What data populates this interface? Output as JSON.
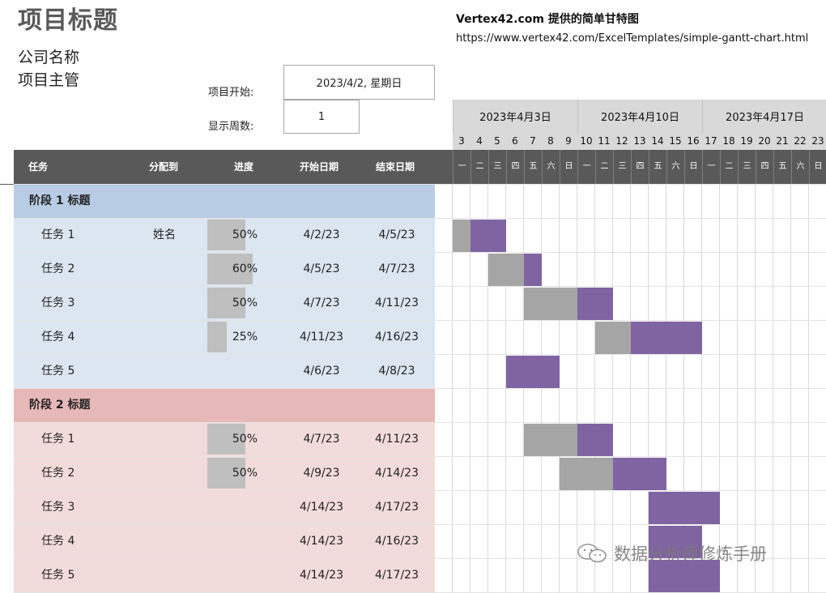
{
  "header": {
    "title": "项目标题",
    "company": "公司名称",
    "manager": "项目主管",
    "credit": "Vertex42.com 提供的简单甘特图",
    "url": "https://www.vertex42.com/ExcelTemplates/simple-gantt-chart.html"
  },
  "settings": {
    "start_label": "项目开始:",
    "start_value": "2023/4/2, 星期日",
    "weeks_label": "显示周数:",
    "weeks_value": "1"
  },
  "columns": {
    "task": "任务",
    "assigned": "分配到",
    "progress": "进度",
    "start": "开始日期",
    "end": "结束日期"
  },
  "timeline": {
    "weeks": [
      "2023年4月3日",
      "2023年4月10日",
      "2023年4月17日"
    ],
    "days": [
      "3",
      "4",
      "5",
      "6",
      "7",
      "8",
      "9",
      "10",
      "11",
      "12",
      "13",
      "14",
      "15",
      "16",
      "17",
      "18",
      "19",
      "20",
      "21",
      "22",
      "23"
    ],
    "day_names": [
      "一",
      "二",
      "三",
      "四",
      "五",
      "六",
      "日",
      "一",
      "二",
      "三",
      "四",
      "五",
      "六",
      "日",
      "一",
      "二",
      "三",
      "四",
      "五",
      "六",
      "日"
    ]
  },
  "phases": [
    {
      "label": "阶段 1 标题",
      "header_color": "#b8cce4",
      "row_color": "#dce6f1",
      "tasks": [
        {
          "name": "任务 1",
          "assigned": "姓名",
          "progress": "50%",
          "progress_value": 0.5,
          "start": "4/2/23",
          "end": "4/5/23"
        },
        {
          "name": "任务 2",
          "assigned": "",
          "progress": "60%",
          "progress_value": 0.6,
          "start": "4/5/23",
          "end": "4/7/23"
        },
        {
          "name": "任务 3",
          "assigned": "",
          "progress": "50%",
          "progress_value": 0.5,
          "start": "4/7/23",
          "end": "4/11/23"
        },
        {
          "name": "任务 4",
          "assigned": "",
          "progress": "25%",
          "progress_value": 0.25,
          "start": "4/11/23",
          "end": "4/16/23"
        },
        {
          "name": "任务 5",
          "assigned": "",
          "progress": "",
          "progress_value": 0,
          "start": "4/6/23",
          "end": "4/8/23"
        }
      ]
    },
    {
      "label": "阶段 2 标题",
      "header_color": "#e6b8b7",
      "row_color": "#f2dcdb",
      "tasks": [
        {
          "name": "任务 1",
          "assigned": "",
          "progress": "50%",
          "progress_value": 0.5,
          "start": "4/7/23",
          "end": "4/11/23"
        },
        {
          "name": "任务 2",
          "assigned": "",
          "progress": "50%",
          "progress_value": 0.5,
          "start": "4/9/23",
          "end": "4/14/23"
        },
        {
          "name": "任务 3",
          "assigned": "",
          "progress": "",
          "progress_value": 0,
          "start": "4/14/23",
          "end": "4/17/23"
        },
        {
          "name": "任务 4",
          "assigned": "",
          "progress": "",
          "progress_value": 0,
          "start": "4/14/23",
          "end": "4/16/23"
        },
        {
          "name": "任务 5",
          "assigned": "",
          "progress": "",
          "progress_value": 0,
          "start": "4/14/23",
          "end": "4/17/23"
        }
      ]
    }
  ],
  "colors": {
    "done": "#a5a5a5",
    "remaining": "#8064a2",
    "header_dark": "#595959",
    "header_light": "#d9d9d9"
  },
  "watermark": {
    "icon": "wechat-icon",
    "text": "数据分析师修炼手册"
  }
}
